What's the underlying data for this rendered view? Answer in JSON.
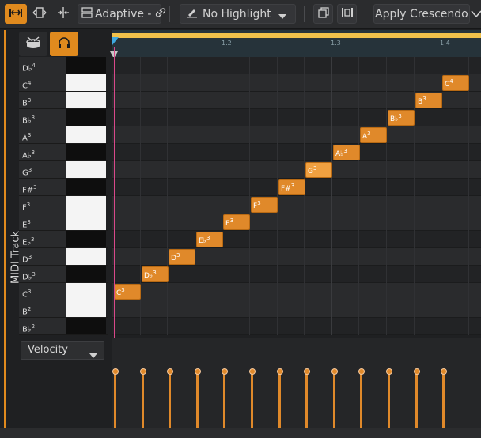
{
  "toolbar": {
    "snap_label": "Adaptive -",
    "highlight_label": "No Highlight",
    "action_label": "Apply Crescendo"
  },
  "track": {
    "name": "MIDI Track"
  },
  "ruler": {
    "ticks": [
      "1.2",
      "1.3",
      "1.4"
    ]
  },
  "keys": [
    {
      "note": "D♭",
      "oct": "4",
      "black": true
    },
    {
      "note": "C",
      "oct": "4",
      "black": false
    },
    {
      "note": "B",
      "oct": "3",
      "black": false
    },
    {
      "note": "B♭",
      "oct": "3",
      "black": true
    },
    {
      "note": "A",
      "oct": "3",
      "black": false
    },
    {
      "note": "A♭",
      "oct": "3",
      "black": true
    },
    {
      "note": "G",
      "oct": "3",
      "black": false
    },
    {
      "note": "F#",
      "oct": "3",
      "black": true
    },
    {
      "note": "F",
      "oct": "3",
      "black": false
    },
    {
      "note": "E",
      "oct": "3",
      "black": false
    },
    {
      "note": "E♭",
      "oct": "3",
      "black": true
    },
    {
      "note": "D",
      "oct": "3",
      "black": false
    },
    {
      "note": "D♭",
      "oct": "3",
      "black": true
    },
    {
      "note": "C",
      "oct": "3",
      "black": false
    },
    {
      "note": "B",
      "oct": "2",
      "black": false
    },
    {
      "note": "B♭",
      "oct": "2",
      "black": true
    }
  ],
  "notes": [
    {
      "note": "C",
      "oct": "3"
    },
    {
      "note": "D♭",
      "oct": "3"
    },
    {
      "note": "D",
      "oct": "3"
    },
    {
      "note": "E♭",
      "oct": "3"
    },
    {
      "note": "E",
      "oct": "3"
    },
    {
      "note": "F",
      "oct": "3"
    },
    {
      "note": "F#",
      "oct": "3"
    },
    {
      "note": "G",
      "oct": "3"
    },
    {
      "note": "A♭",
      "oct": "3"
    },
    {
      "note": "A",
      "oct": "3"
    },
    {
      "note": "B♭",
      "oct": "3"
    },
    {
      "note": "B",
      "oct": "3"
    },
    {
      "note": "C",
      "oct": "4"
    }
  ],
  "velocity": {
    "label": "Velocity",
    "count": 13
  },
  "colors": {
    "accent": "#e08a1e",
    "playhead": "#d9488a",
    "loop": "#f0c14b"
  }
}
